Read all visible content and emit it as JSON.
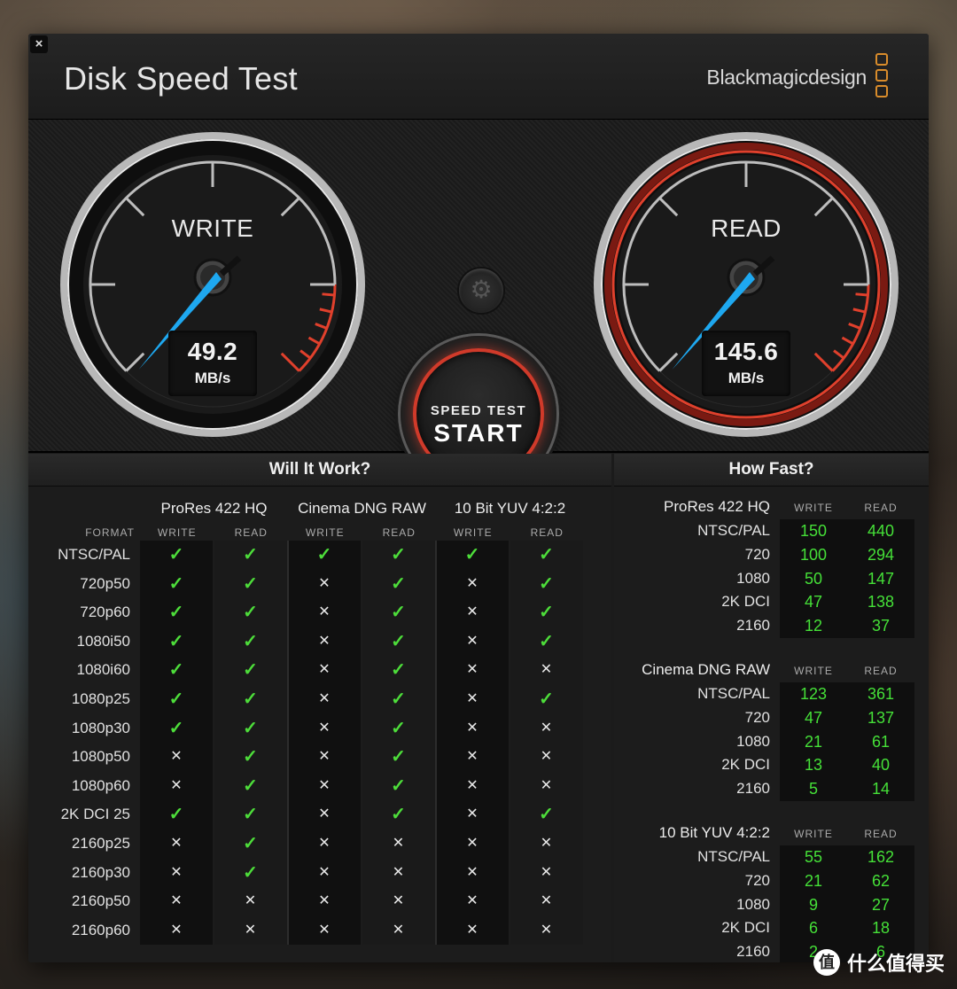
{
  "window": {
    "title": "Disk Speed Test",
    "brand": "Blackmagicdesign",
    "close_label": "×"
  },
  "gauges": {
    "write": {
      "label": "WRITE",
      "value": "49.2",
      "unit": "MB/s"
    },
    "read": {
      "label": "READ",
      "value": "145.6",
      "unit": "MB/s"
    }
  },
  "start_button": {
    "line1": "SPEED TEST",
    "line2": "START"
  },
  "settings_icon": "⚙",
  "will_it_work": {
    "title": "Will It Work?",
    "format_label": "FORMAT",
    "codecs": [
      "ProRes 422 HQ",
      "Cinema DNG RAW",
      "10 Bit YUV 4:2:2"
    ],
    "sub_cols": [
      "WRITE",
      "READ",
      "WRITE",
      "READ",
      "WRITE",
      "READ"
    ],
    "rows": [
      {
        "format": "NTSC/PAL",
        "results": [
          1,
          1,
          1,
          1,
          1,
          1
        ]
      },
      {
        "format": "720p50",
        "results": [
          1,
          1,
          0,
          1,
          0,
          1
        ]
      },
      {
        "format": "720p60",
        "results": [
          1,
          1,
          0,
          1,
          0,
          1
        ]
      },
      {
        "format": "1080i50",
        "results": [
          1,
          1,
          0,
          1,
          0,
          1
        ]
      },
      {
        "format": "1080i60",
        "results": [
          1,
          1,
          0,
          1,
          0,
          0
        ]
      },
      {
        "format": "1080p25",
        "results": [
          1,
          1,
          0,
          1,
          0,
          1
        ]
      },
      {
        "format": "1080p30",
        "results": [
          1,
          1,
          0,
          1,
          0,
          0
        ]
      },
      {
        "format": "1080p50",
        "results": [
          0,
          1,
          0,
          1,
          0,
          0
        ]
      },
      {
        "format": "1080p60",
        "results": [
          0,
          1,
          0,
          1,
          0,
          0
        ]
      },
      {
        "format": "2K DCI 25",
        "results": [
          1,
          1,
          0,
          1,
          0,
          1
        ]
      },
      {
        "format": "2160p25",
        "results": [
          0,
          1,
          0,
          0,
          0,
          0
        ]
      },
      {
        "format": "2160p30",
        "results": [
          0,
          1,
          0,
          0,
          0,
          0
        ]
      },
      {
        "format": "2160p50",
        "results": [
          0,
          0,
          0,
          0,
          0,
          0
        ]
      },
      {
        "format": "2160p60",
        "results": [
          0,
          0,
          0,
          0,
          0,
          0
        ]
      }
    ],
    "ok_symbol": "✓",
    "no_symbol": "✕"
  },
  "how_fast": {
    "title": "How Fast?",
    "write_label": "WRITE",
    "read_label": "READ",
    "groups": [
      {
        "codec": "ProRes 422 HQ",
        "rows": [
          {
            "format": "NTSC/PAL",
            "write": "150",
            "read": "440"
          },
          {
            "format": "720",
            "write": "100",
            "read": "294"
          },
          {
            "format": "1080",
            "write": "50",
            "read": "147"
          },
          {
            "format": "2K DCI",
            "write": "47",
            "read": "138"
          },
          {
            "format": "2160",
            "write": "12",
            "read": "37"
          }
        ]
      },
      {
        "codec": "Cinema DNG RAW",
        "rows": [
          {
            "format": "NTSC/PAL",
            "write": "123",
            "read": "361"
          },
          {
            "format": "720",
            "write": "47",
            "read": "137"
          },
          {
            "format": "1080",
            "write": "21",
            "read": "61"
          },
          {
            "format": "2K DCI",
            "write": "13",
            "read": "40"
          },
          {
            "format": "2160",
            "write": "5",
            "read": "14"
          }
        ]
      },
      {
        "codec": "10 Bit YUV 4:2:2",
        "rows": [
          {
            "format": "NTSC/PAL",
            "write": "55",
            "read": "162"
          },
          {
            "format": "720",
            "write": "21",
            "read": "62"
          },
          {
            "format": "1080",
            "write": "9",
            "read": "27"
          },
          {
            "format": "2K DCI",
            "write": "6",
            "read": "18"
          },
          {
            "format": "2160",
            "write": "2",
            "read": "6"
          }
        ]
      }
    ]
  },
  "watermark": {
    "icon": "值",
    "text": "什么值得买"
  },
  "colors": {
    "ok": "#4ddd3a",
    "needle": "#1ea8f0",
    "red_ring": "#d03a2a",
    "logo": "#d98c2b"
  }
}
